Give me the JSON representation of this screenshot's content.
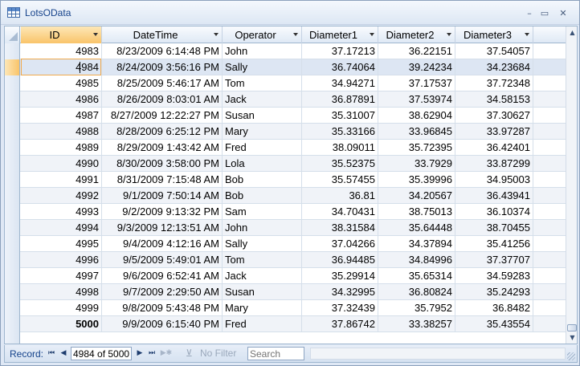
{
  "window": {
    "title": "LotsOData",
    "minimize_glyph": "–",
    "restore_glyph": "▭",
    "close_glyph": "✕",
    "icon": "datasheet-table-icon"
  },
  "columns": [
    {
      "key": "id",
      "label": "ID",
      "align": "num"
    },
    {
      "key": "datetime",
      "label": "DateTime",
      "align": "num"
    },
    {
      "key": "operator",
      "label": "Operator",
      "align": "txt"
    },
    {
      "key": "d1",
      "label": "Diameter1",
      "align": "num"
    },
    {
      "key": "d2",
      "label": "Diameter2",
      "align": "num"
    },
    {
      "key": "d3",
      "label": "Diameter3",
      "align": "num"
    }
  ],
  "rows": [
    {
      "id": "4983",
      "datetime": "8/23/2009 6:14:48 PM",
      "operator": "John",
      "d1": "37.17213",
      "d2": "36.22151",
      "d3": "37.54057"
    },
    {
      "id": "4984",
      "datetime": "8/24/2009 3:56:16 PM",
      "operator": "Sally",
      "d1": "36.74064",
      "d2": "39.24234",
      "d3": "34.23684"
    },
    {
      "id": "4985",
      "datetime": "8/25/2009 5:46:17 AM",
      "operator": "Tom",
      "d1": "34.94271",
      "d2": "37.17537",
      "d3": "37.72348"
    },
    {
      "id": "4986",
      "datetime": "8/26/2009 8:03:01 AM",
      "operator": "Jack",
      "d1": "36.87891",
      "d2": "37.53974",
      "d3": "34.58153"
    },
    {
      "id": "4987",
      "datetime": "8/27/2009 12:22:27 PM",
      "operator": "Susan",
      "d1": "35.31007",
      "d2": "38.62904",
      "d3": "37.30627"
    },
    {
      "id": "4988",
      "datetime": "8/28/2009 6:25:12 PM",
      "operator": "Mary",
      "d1": "35.33166",
      "d2": "33.96845",
      "d3": "33.97287"
    },
    {
      "id": "4989",
      "datetime": "8/29/2009 1:43:42 AM",
      "operator": "Fred",
      "d1": "38.09011",
      "d2": "35.72395",
      "d3": "36.42401"
    },
    {
      "id": "4990",
      "datetime": "8/30/2009 3:58:00 PM",
      "operator": "Lola",
      "d1": "35.52375",
      "d2": "33.7929",
      "d3": "33.87299"
    },
    {
      "id": "4991",
      "datetime": "8/31/2009 7:15:48 AM",
      "operator": "Bob",
      "d1": "35.57455",
      "d2": "35.39996",
      "d3": "34.95003"
    },
    {
      "id": "4992",
      "datetime": "9/1/2009 7:50:14 AM",
      "operator": "Bob",
      "d1": "36.81",
      "d2": "34.20567",
      "d3": "36.43941"
    },
    {
      "id": "4993",
      "datetime": "9/2/2009 9:13:32 PM",
      "operator": "Sam",
      "d1": "34.70431",
      "d2": "38.75013",
      "d3": "36.10374"
    },
    {
      "id": "4994",
      "datetime": "9/3/2009 12:13:51 AM",
      "operator": "John",
      "d1": "38.31584",
      "d2": "35.64448",
      "d3": "38.70455"
    },
    {
      "id": "4995",
      "datetime": "9/4/2009 4:12:16 AM",
      "operator": "Sally",
      "d1": "37.04266",
      "d2": "34.37894",
      "d3": "35.41256"
    },
    {
      "id": "4996",
      "datetime": "9/5/2009 5:49:01 AM",
      "operator": "Tom",
      "d1": "36.94485",
      "d2": "34.84996",
      "d3": "37.37707"
    },
    {
      "id": "4997",
      "datetime": "9/6/2009 6:52:41 AM",
      "operator": "Jack",
      "d1": "35.29914",
      "d2": "35.65314",
      "d3": "34.59283"
    },
    {
      "id": "4998",
      "datetime": "9/7/2009 2:29:50 AM",
      "operator": "Susan",
      "d1": "34.32995",
      "d2": "36.80824",
      "d3": "35.24293"
    },
    {
      "id": "4999",
      "datetime": "9/8/2009 5:43:48 PM",
      "operator": "Mary",
      "d1": "37.32439",
      "d2": "35.7952",
      "d3": "36.8482"
    },
    {
      "id": "5000",
      "datetime": "9/9/2009 6:15:40 PM",
      "operator": "Fred",
      "d1": "37.86742",
      "d2": "33.38257",
      "d3": "35.43554"
    }
  ],
  "current_record_id": "4984",
  "navigator": {
    "label": "Record:",
    "position": "4984 of 5000",
    "first_glyph": "⏮",
    "prev_glyph": "◀",
    "next_glyph": "▶",
    "last_glyph": "⏭",
    "new_glyph": "▶✱",
    "filter_label": "No Filter",
    "filter_icon": "funnel-x-icon",
    "search_placeholder": "Search"
  },
  "scroll": {
    "up_glyph": "▲",
    "down_glyph": "▼"
  },
  "colors": {
    "accent": "#f9c46a",
    "title_text": "#15428b",
    "grid_line": "#d5dfea"
  }
}
